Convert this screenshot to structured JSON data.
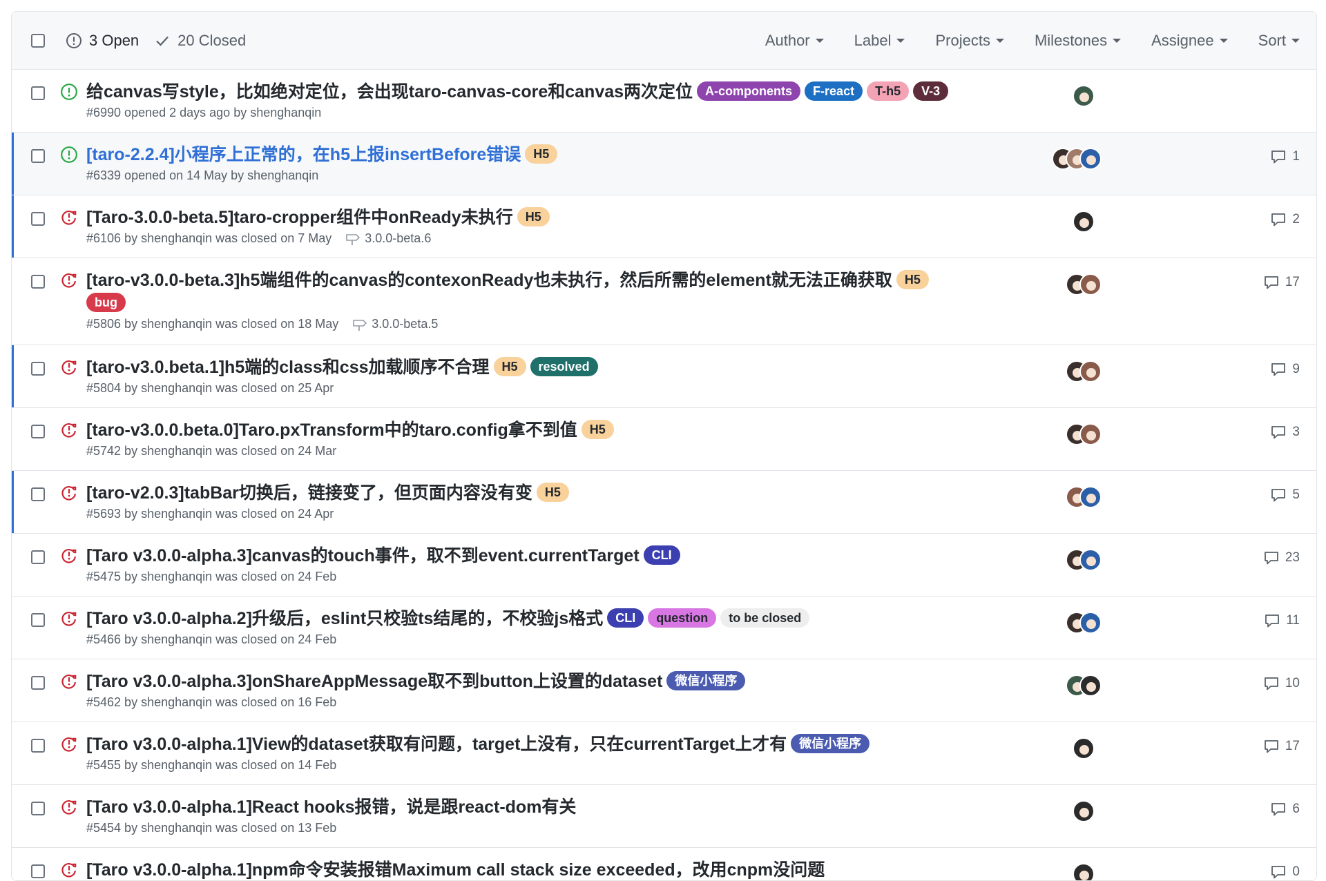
{
  "header": {
    "open_label": "3 Open",
    "closed_label": "20 Closed",
    "filters": [
      "Author",
      "Label",
      "Projects",
      "Milestones",
      "Assignee",
      "Sort"
    ]
  },
  "colors": {
    "open_icon": "#28a745",
    "closed_icon": "#cb2431",
    "highlight_bar": "#2f6fd6",
    "link_blue": "#2f6fd6"
  },
  "issues": [
    {
      "title": "给canvas写style，比如绝对定位，会出现taro-canvas-core和canvas两次定位",
      "state": "open",
      "labels": [
        {
          "text": "A-components",
          "bg": "#8e44ad",
          "fg": "#ffffff"
        },
        {
          "text": "F-react",
          "bg": "#1d6fc4",
          "fg": "#ffffff"
        },
        {
          "text": "T-h5",
          "bg": "#f4a3b5",
          "fg": "#24292e"
        },
        {
          "text": "V-3",
          "bg": "#5e2d3b",
          "fg": "#ffffff"
        }
      ],
      "meta": "#6990 opened 2 days ago by shenghanqin",
      "milestone": "",
      "comments": "",
      "avatars": [
        "#3c5a4a"
      ]
    },
    {
      "title": "[taro-2.2.4]小程序上正常的，在h5上报insertBefore错误",
      "state": "open",
      "link": true,
      "labels": [
        {
          "text": "H5",
          "bg": "#f8d19b",
          "fg": "#24292e"
        }
      ],
      "meta": "#6339 opened on 14 May by shenghanqin",
      "milestone": "",
      "comments": "1",
      "avatars": [
        "#3a2f2a",
        "#a07b6a",
        "#2b5fa8"
      ]
    },
    {
      "title": "[Taro-3.0.0-beta.5]taro-cropper组件中onReady未执行",
      "state": "closed",
      "labels": [
        {
          "text": "H5",
          "bg": "#f8d19b",
          "fg": "#24292e"
        }
      ],
      "meta": "#6106 by shenghanqin was closed on 7 May",
      "milestone": "3.0.0-beta.6",
      "comments": "2",
      "avatars": [
        "#2b2b2b"
      ]
    },
    {
      "title": "[taro-v3.0.0-beta.3]h5端组件的canvas的contexonReady也未执行，然后所需的element就无法正确获取",
      "state": "closed",
      "labels": [
        {
          "text": "H5",
          "bg": "#f8d19b",
          "fg": "#24292e"
        },
        {
          "text": "bug",
          "bg": "#d73a4a",
          "fg": "#ffffff"
        }
      ],
      "meta": "#5806 by shenghanqin was closed on 18 May",
      "milestone": "3.0.0-beta.5",
      "comments": "17",
      "avatars": [
        "#3a2f2a",
        "#8a5a4a"
      ]
    },
    {
      "title": "[taro-v3.0.beta.1]h5端的class和css加载顺序不合理",
      "state": "closed",
      "labels": [
        {
          "text": "H5",
          "bg": "#f8d19b",
          "fg": "#24292e"
        },
        {
          "text": "resolved",
          "bg": "#1f6f6a",
          "fg": "#ffffff"
        }
      ],
      "meta": "#5804 by shenghanqin was closed on 25 Apr",
      "milestone": "",
      "comments": "9",
      "avatars": [
        "#3a2f2a",
        "#8a5a4a"
      ]
    },
    {
      "title": "[taro-v3.0.0.beta.0]Taro.pxTransform中的taro.config拿不到值",
      "state": "closed",
      "labels": [
        {
          "text": "H5",
          "bg": "#f8d19b",
          "fg": "#24292e"
        }
      ],
      "meta": "#5742 by shenghanqin was closed on 24 Mar",
      "milestone": "",
      "comments": "3",
      "avatars": [
        "#3a2f2a",
        "#8a5a4a"
      ]
    },
    {
      "title": "[taro-v2.0.3]tabBar切换后，链接变了，但页面内容没有变",
      "state": "closed",
      "labels": [
        {
          "text": "H5",
          "bg": "#f8d19b",
          "fg": "#24292e"
        }
      ],
      "meta": "#5693 by shenghanqin was closed on 24 Apr",
      "milestone": "",
      "comments": "5",
      "avatars": [
        "#8a5a4a",
        "#2b5fa8"
      ]
    },
    {
      "title": "[Taro v3.0.0-alpha.3]canvas的touch事件，取不到event.currentTarget",
      "state": "closed",
      "labels": [
        {
          "text": "CLI",
          "bg": "#3b3fb0",
          "fg": "#ffffff"
        }
      ],
      "meta": "#5475 by shenghanqin was closed on 24 Feb",
      "milestone": "",
      "comments": "23",
      "avatars": [
        "#3a2f2a",
        "#2b5fa8"
      ]
    },
    {
      "title": "[Taro v3.0.0-alpha.2]升级后，eslint只校验ts结尾的，不校验js格式",
      "state": "closed",
      "labels": [
        {
          "text": "CLI",
          "bg": "#3b3fb0",
          "fg": "#ffffff"
        },
        {
          "text": "question",
          "bg": "#d876e3",
          "fg": "#24292e"
        },
        {
          "text": "to be closed",
          "bg": "#eeeeee",
          "fg": "#24292e"
        }
      ],
      "meta": "#5466 by shenghanqin was closed on 24 Feb",
      "milestone": "",
      "comments": "11",
      "avatars": [
        "#3a2f2a",
        "#2b5fa8"
      ]
    },
    {
      "title": "[Taro v3.0.0-alpha.3]onShareAppMessage取不到button上设置的dataset",
      "state": "closed",
      "labels": [
        {
          "text": "微信小程序",
          "bg": "#4a5bb0",
          "fg": "#ffffff"
        }
      ],
      "meta": "#5462 by shenghanqin was closed on 16 Feb",
      "milestone": "",
      "comments": "10",
      "avatars": [
        "#3c5a4a",
        "#2b2b2b"
      ]
    },
    {
      "title": "[Taro v3.0.0-alpha.1]View的dataset获取有问题，target上没有，只在currentTarget上才有",
      "state": "closed",
      "labels": [
        {
          "text": "微信小程序",
          "bg": "#4a5bb0",
          "fg": "#ffffff"
        }
      ],
      "meta": "#5455 by shenghanqin was closed on 14 Feb",
      "milestone": "",
      "comments": "17",
      "avatars": [
        "#2b2b2b"
      ]
    },
    {
      "title": "[Taro v3.0.0-alpha.1]React hooks报错，说是跟react-dom有关",
      "state": "closed",
      "labels": [],
      "meta": "#5454 by shenghanqin was closed on 13 Feb",
      "milestone": "",
      "comments": "6",
      "avatars": [
        "#2b2b2b"
      ]
    },
    {
      "title": "[Taro v3.0.0-alpha.1]npm命令安装报错Maximum call stack size exceeded，改用cnpm没问题",
      "state": "closed",
      "labels": [],
      "meta": "",
      "milestone": "",
      "comments": "0",
      "avatars": [
        "#2b2b2b"
      ]
    }
  ]
}
